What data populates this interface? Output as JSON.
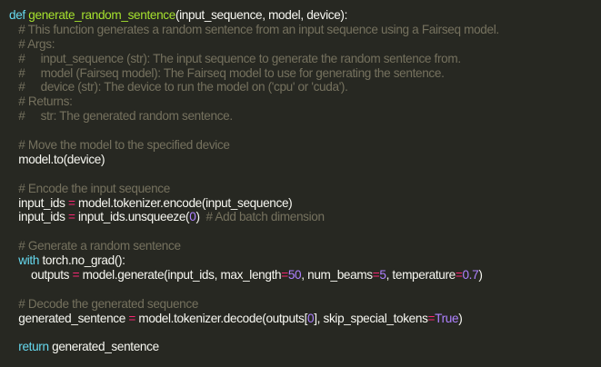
{
  "editor": {
    "theme": {
      "background": "#272822",
      "colors": {
        "plain": "#f8f8f2",
        "keyword": "#66d9ef",
        "function": "#a6e22e",
        "comment": "#75715e",
        "number": "#ae81ff",
        "operator": "#f92672",
        "constant": "#ae81ff"
      }
    },
    "lines": [
      [
        {
          "t": "def",
          "k": "keyword"
        },
        {
          "t": " ",
          "k": "plain"
        },
        {
          "t": "generate_random_sentence",
          "k": "function"
        },
        {
          "t": "(input_sequence, model, device):",
          "k": "plain"
        }
      ],
      [
        {
          "t": "   # This function generates a random sentence from an input sequence using a Fairseq model.",
          "k": "comment"
        }
      ],
      [
        {
          "t": "   # Args:",
          "k": "comment"
        }
      ],
      [
        {
          "t": "   #     input_sequence (str): The input sequence to generate the random sentence from.",
          "k": "comment"
        }
      ],
      [
        {
          "t": "   #     model (Fairseq model): The Fairseq model to use for generating the sentence.",
          "k": "comment"
        }
      ],
      [
        {
          "t": "   #     device (str): The device to run the model on ('cpu' or 'cuda').",
          "k": "comment"
        }
      ],
      [
        {
          "t": "   # Returns:",
          "k": "comment"
        }
      ],
      [
        {
          "t": "   #     str: The generated random sentence.",
          "k": "comment"
        }
      ],
      [],
      [
        {
          "t": "   # Move the model to the specified device",
          "k": "comment"
        }
      ],
      [
        {
          "t": "   model.to(device)",
          "k": "plain"
        }
      ],
      [],
      [
        {
          "t": "   # Encode the input sequence",
          "k": "comment"
        }
      ],
      [
        {
          "t": "   input_ids ",
          "k": "plain"
        },
        {
          "t": "=",
          "k": "operator"
        },
        {
          "t": " model.tokenizer.encode(input_sequence)",
          "k": "plain"
        }
      ],
      [
        {
          "t": "   input_ids ",
          "k": "plain"
        },
        {
          "t": "=",
          "k": "operator"
        },
        {
          "t": " input_ids.unsqueeze(",
          "k": "plain"
        },
        {
          "t": "0",
          "k": "number"
        },
        {
          "t": ")  ",
          "k": "plain"
        },
        {
          "t": "# Add batch dimension",
          "k": "comment"
        }
      ],
      [],
      [
        {
          "t": "   # Generate a random sentence",
          "k": "comment"
        }
      ],
      [
        {
          "t": "   ",
          "k": "plain"
        },
        {
          "t": "with",
          "k": "keyword"
        },
        {
          "t": " torch.no_grad():",
          "k": "plain"
        }
      ],
      [
        {
          "t": "       outputs ",
          "k": "plain"
        },
        {
          "t": "=",
          "k": "operator"
        },
        {
          "t": " model.generate(input_ids, max_length",
          "k": "plain"
        },
        {
          "t": "=",
          "k": "operator"
        },
        {
          "t": "50",
          "k": "number"
        },
        {
          "t": ", num_beams",
          "k": "plain"
        },
        {
          "t": "=",
          "k": "operator"
        },
        {
          "t": "5",
          "k": "number"
        },
        {
          "t": ", temperature",
          "k": "plain"
        },
        {
          "t": "=",
          "k": "operator"
        },
        {
          "t": "0.7",
          "k": "number"
        },
        {
          "t": ")",
          "k": "plain"
        }
      ],
      [],
      [
        {
          "t": "   # Decode the generated sequence",
          "k": "comment"
        }
      ],
      [
        {
          "t": "   generated_sentence ",
          "k": "plain"
        },
        {
          "t": "=",
          "k": "operator"
        },
        {
          "t": " model.tokenizer.decode(outputs[",
          "k": "plain"
        },
        {
          "t": "0",
          "k": "number"
        },
        {
          "t": "], skip_special_tokens",
          "k": "plain"
        },
        {
          "t": "=",
          "k": "operator"
        },
        {
          "t": "True",
          "k": "constant"
        },
        {
          "t": ")",
          "k": "plain"
        }
      ],
      [],
      [
        {
          "t": "   ",
          "k": "plain"
        },
        {
          "t": "return",
          "k": "keyword"
        },
        {
          "t": " generated_sentence",
          "k": "plain"
        }
      ]
    ]
  }
}
